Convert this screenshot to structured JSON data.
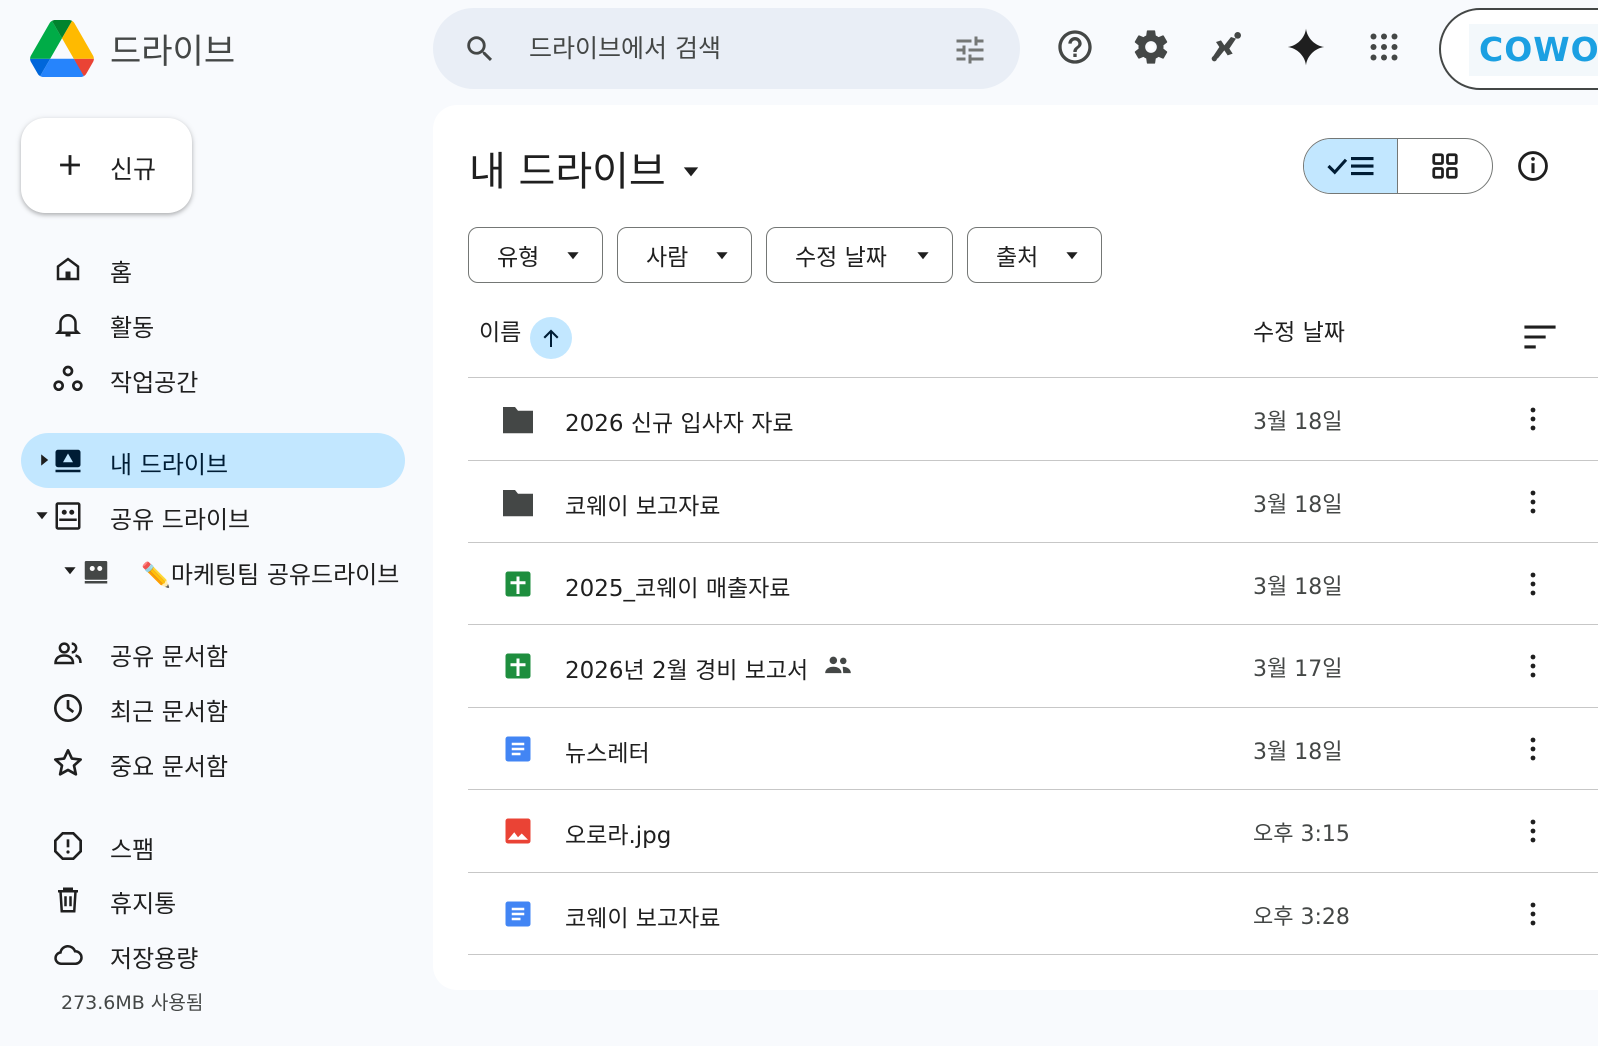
{
  "app": {
    "title": "드라이브"
  },
  "search": {
    "placeholder": "드라이브에서 검색"
  },
  "account": {
    "brand_text": "COWO"
  },
  "sidebar": {
    "new_label": "신규",
    "items": [
      {
        "label": "홈"
      },
      {
        "label": "활동"
      },
      {
        "label": "작업공간"
      },
      {
        "label": "내 드라이브"
      },
      {
        "label": "공유 드라이브"
      },
      {
        "label": "✏️마케팅팀 공유드라이브"
      },
      {
        "label": "공유 문서함"
      },
      {
        "label": "최근 문서함"
      },
      {
        "label": "중요 문서함"
      },
      {
        "label": "스팸"
      },
      {
        "label": "휴지통"
      },
      {
        "label": "저장용량"
      }
    ],
    "storage_used": "273.6MB 사용됨"
  },
  "main": {
    "title": "내 드라이브",
    "filters": [
      "유형",
      "사람",
      "수정 날짜",
      "출처"
    ],
    "columns": {
      "name": "이름",
      "modified": "수정 날짜"
    },
    "files": [
      {
        "name": "2026 신규 입사자 자료",
        "date": "3월 18일",
        "type": "folder"
      },
      {
        "name": "코웨이 보고자료",
        "date": "3월 18일",
        "type": "folder"
      },
      {
        "name": "2025_코웨이 매출자료",
        "date": "3월 18일",
        "type": "sheet"
      },
      {
        "name": "2026년 2월 경비 보고서",
        "date": "3월 17일",
        "type": "sheet",
        "shared": true
      },
      {
        "name": "뉴스레터",
        "date": "3월 18일",
        "type": "doc"
      },
      {
        "name": "오로라.jpg",
        "date": "오후 3:15",
        "type": "image"
      },
      {
        "name": "코웨이 보고자료",
        "date": "오후 3:28",
        "type": "doc"
      }
    ]
  },
  "colors": {
    "accent": "#c2e7ff",
    "folder": "#444746",
    "sheet": "#1e8e3e",
    "doc": "#4285f4",
    "image": "#ea4335"
  }
}
